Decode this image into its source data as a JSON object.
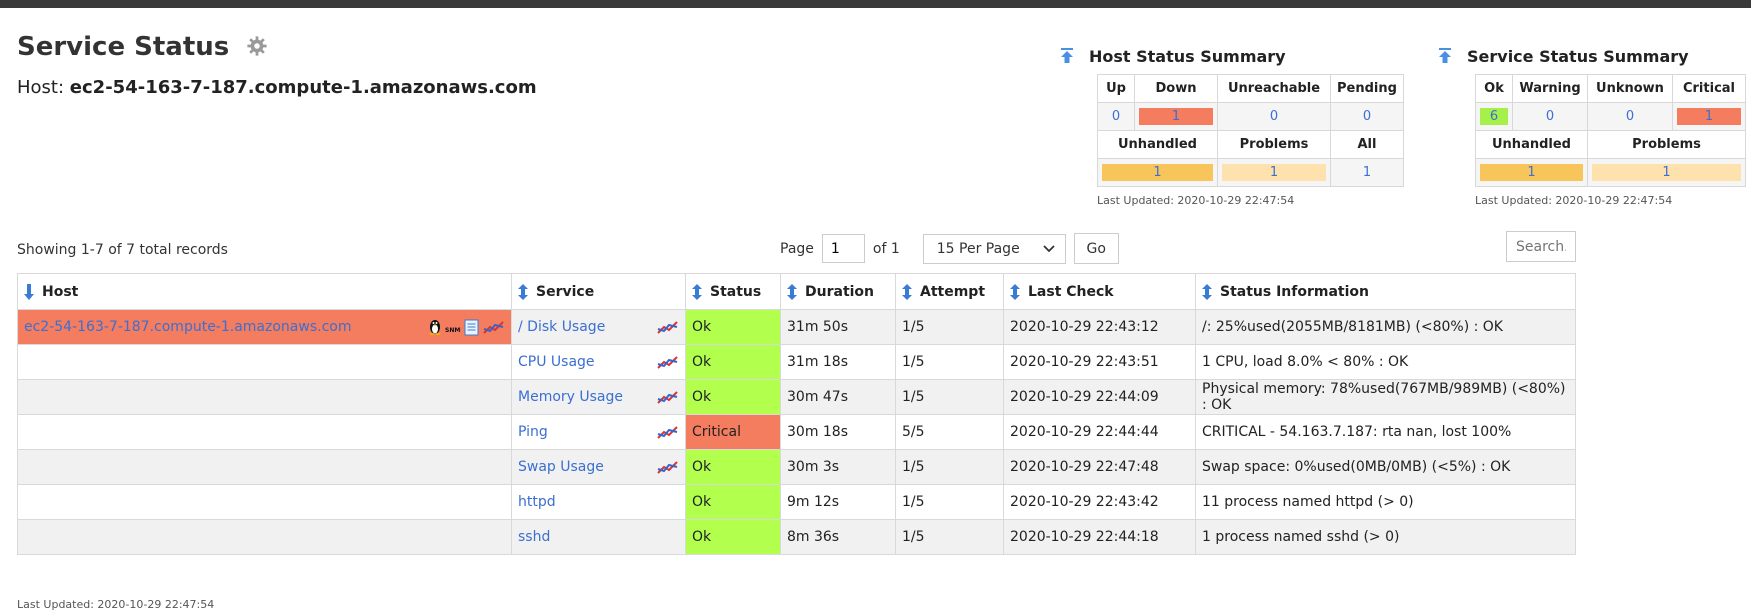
{
  "header": {
    "title": "Service Status",
    "host_label": "Host:",
    "host_name": "ec2-54-163-7-187.compute-1.amazonaws.com"
  },
  "host_summary": {
    "title": "Host Status Summary",
    "row1_headers": [
      "Up",
      "Down",
      "Unreachable",
      "Pending"
    ],
    "row1_values": [
      "0",
      "1",
      "0",
      "0"
    ],
    "row2_headers": [
      "Unhandled",
      "Problems",
      "All"
    ],
    "row2_values": [
      "1",
      "1",
      "1"
    ],
    "last_updated": "Last Updated: 2020-10-29 22:47:54"
  },
  "service_summary": {
    "title": "Service Status Summary",
    "row1_headers": [
      "Ok",
      "Warning",
      "Unknown",
      "Critical"
    ],
    "row1_values": [
      "6",
      "0",
      "0",
      "1"
    ],
    "row2_headers": [
      "Unhandled",
      "Problems"
    ],
    "row2_values": [
      "1",
      "1"
    ],
    "last_updated": "Last Updated: 2020-10-29 22:47:54"
  },
  "records": {
    "showing": "Showing 1-7 of 7 total records",
    "page_label": "Page",
    "page_value": "1",
    "of_label": "of 1",
    "per_page": "15 Per Page",
    "go_label": "Go",
    "search_placeholder": "Search..."
  },
  "table": {
    "columns": [
      "Host",
      "Service",
      "Status",
      "Duration",
      "Attempt",
      "Last Check",
      "Status Information"
    ],
    "host": "ec2-54-163-7-187.compute-1.amazonaws.com",
    "rows": [
      {
        "service": "/ Disk Usage",
        "status": "Ok",
        "duration": "31m 50s",
        "attempt": "1/5",
        "last_check": "2020-10-29 22:43:12",
        "info": "/: 25%used(2055MB/8181MB) (<80%) : OK"
      },
      {
        "service": "CPU Usage",
        "status": "Ok",
        "duration": "31m 18s",
        "attempt": "1/5",
        "last_check": "2020-10-29 22:43:51",
        "info": "1 CPU, load 8.0% < 80% : OK"
      },
      {
        "service": "Memory Usage",
        "status": "Ok",
        "duration": "30m 47s",
        "attempt": "1/5",
        "last_check": "2020-10-29 22:44:09",
        "info": "Physical memory: 78%used(767MB/989MB) (<80%) : OK"
      },
      {
        "service": "Ping",
        "status": "Critical",
        "duration": "30m 18s",
        "attempt": "5/5",
        "last_check": "2020-10-29 22:44:44",
        "info": "CRITICAL - 54.163.7.187: rta nan, lost 100%"
      },
      {
        "service": "Swap Usage",
        "status": "Ok",
        "duration": "30m 3s",
        "attempt": "1/5",
        "last_check": "2020-10-29 22:47:48",
        "info": "Swap space: 0%used(0MB/0MB) (<5%) : OK"
      },
      {
        "service": "httpd",
        "status": "Ok",
        "duration": "9m 12s",
        "attempt": "1/5",
        "last_check": "2020-10-29 22:43:42",
        "info": "11 process named httpd (> 0)"
      },
      {
        "service": "sshd",
        "status": "Ok",
        "duration": "8m 36s",
        "attempt": "1/5",
        "last_check": "2020-10-29 22:44:18",
        "info": "1 process named sshd (> 0)"
      }
    ]
  },
  "footer": {
    "last_updated": "Last Updated: 2020-10-29 22:47:54"
  },
  "colors": {
    "critical": "#f47c5f",
    "ok": "#b2ff4d",
    "unhandled": "#f8c55a",
    "problems": "#fde2ae",
    "link": "#3b6fd1"
  },
  "icons": [
    "gear-icon",
    "pin-icon",
    "sort-icon",
    "linux-penguin-icon",
    "snmp-icon",
    "notes-icon",
    "graph-icon",
    "chevron-down-icon"
  ]
}
